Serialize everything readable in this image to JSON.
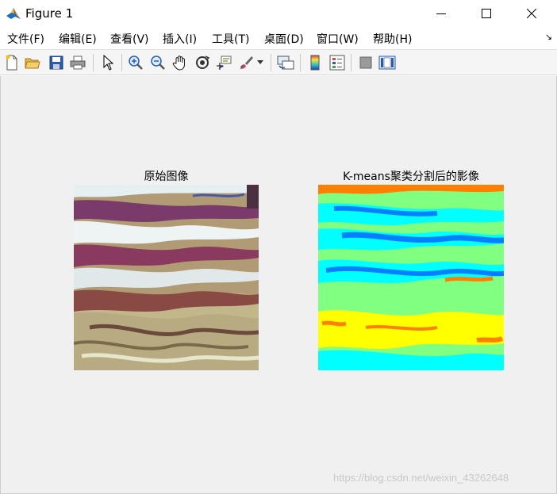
{
  "window": {
    "title": "Figure 1"
  },
  "menu": [
    "文件(F)",
    "编辑(E)",
    "查看(V)",
    "插入(I)",
    "工具(T)",
    "桌面(D)",
    "窗口(W)",
    "帮助(H)"
  ],
  "toolbar": {
    "icons": [
      "new-figure-icon",
      "open-file-icon",
      "save-icon",
      "print-icon",
      "pointer-icon",
      "zoom-in-icon",
      "zoom-out-icon",
      "pan-icon",
      "rotate-3d-icon",
      "data-cursor-icon",
      "brush-icon",
      "brush-dropdown-icon",
      "link-plot-icon",
      "insert-colorbar-icon",
      "insert-legend-icon",
      "hide-plot-tools-icon",
      "show-plot-tools-icon"
    ]
  },
  "figure": {
    "left_title": "原始图像",
    "right_title": "K-means聚类分割后的影像",
    "right_palette": [
      "#0080ff",
      "#00ffff",
      "#80ff80",
      "#ffff00",
      "#ff8000"
    ]
  },
  "watermark": "https://blog.csdn.net/weixin_43262648"
}
